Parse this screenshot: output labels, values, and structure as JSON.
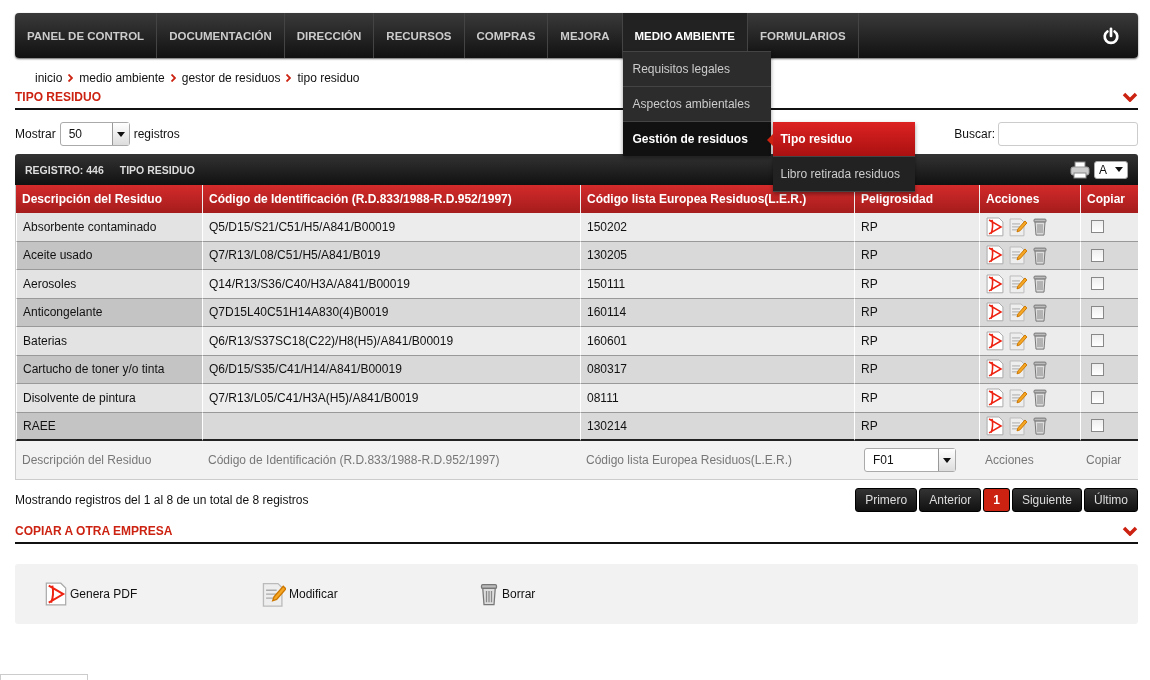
{
  "nav": {
    "items": [
      {
        "label": "PANEL DE CONTROL",
        "selected": false
      },
      {
        "label": "DOCUMENTACIÓN",
        "selected": false
      },
      {
        "label": "DIRECCIÓN",
        "selected": false
      },
      {
        "label": "RECURSOS",
        "selected": false
      },
      {
        "label": "COMPRAS",
        "selected": false
      },
      {
        "label": "MEJORA",
        "selected": false
      },
      {
        "label": "MEDIO AMBIENTE",
        "selected": true,
        "menu": [
          {
            "label": "Requisitos legales",
            "selected": false
          },
          {
            "label": "Aspectos ambientales",
            "selected": false
          },
          {
            "label": "Gestión de residuos",
            "selected": true,
            "submenu": [
              {
                "label": "Tipo residuo",
                "selected": true
              },
              {
                "label": "Libro retirada residuos",
                "selected": false
              }
            ]
          }
        ]
      },
      {
        "label": "FORMULARIOS",
        "selected": false
      }
    ]
  },
  "breadcrumb": [
    "inicio",
    "medio ambiente",
    "gestor de residuos",
    "tipo residuo"
  ],
  "section_title": "TIPO RESIDUO",
  "length_control": {
    "label": "Mostrar",
    "value": "50",
    "suffix": "registros"
  },
  "search": {
    "label": "Buscar:"
  },
  "toolbar": {
    "count": "REGISTRO: 446",
    "title": "TIPO RESIDUO",
    "font_select": "A"
  },
  "table": {
    "columns": [
      "Descripción del Residuo",
      "Código de Identificación (R.D.833/1988-R.D.952/1997)",
      "Código lista Europea Residuos(L.E.R.)",
      "Peligrosidad",
      "Acciones",
      "Copiar"
    ],
    "rows": [
      {
        "descripcion": "Absorbente contaminado",
        "codigo": "Q5/D15/S21/C51/H5/A841/B00019",
        "ler": "150202",
        "peligrosidad": "RP",
        "checked": false
      },
      {
        "descripcion": "Aceite usado",
        "codigo": "Q7/R13/L08/C51/H5/A841/B019",
        "ler": "130205",
        "peligrosidad": "RP",
        "checked": false
      },
      {
        "descripcion": "Aerosoles",
        "codigo": "Q14/R13/S36/C40/H3A/A841/B00019",
        "ler": "150111",
        "peligrosidad": "RP",
        "checked": false
      },
      {
        "descripcion": "Anticongelante",
        "codigo": "Q7D15L40C51H14A830(4)B0019",
        "ler": "160114",
        "peligrosidad": "RP",
        "checked": false
      },
      {
        "descripcion": "Baterias",
        "codigo": "Q6/R13/S37SC18(C22)/H8(H5)/A841/B00019",
        "ler": "160601",
        "peligrosidad": "RP",
        "checked": false
      },
      {
        "descripcion": "Cartucho de toner y/o tinta",
        "codigo": "Q6/D15/S35/C41/H14/A841/B00019",
        "ler": "080317",
        "peligrosidad": "RP",
        "checked": false
      },
      {
        "descripcion": "Disolvente de pintura",
        "codigo": "Q7/R13/L05/C41/H3A(H5)/A841/B0019",
        "ler": "08111",
        "peligrosidad": "RP",
        "checked": false
      },
      {
        "descripcion": "RAEE",
        "ler": "130214",
        "peligrosidad": "RP",
        "checked": false
      }
    ],
    "footer": [
      {
        "kind": "text",
        "label": "Descripción del Residuo"
      },
      {
        "kind": "text",
        "label": "Código de Identificación (R.D.833/1988-R.D.952/1997)"
      },
      {
        "kind": "text",
        "label": "Código lista Europea Residuos(L.E.R.)"
      },
      {
        "kind": "select",
        "value": "F01"
      },
      {
        "kind": "text",
        "label": "Acciones"
      },
      {
        "kind": "text",
        "label": "Copiar"
      }
    ]
  },
  "info": "Mostrando registros del 1 al 8 de un total de 8 registros",
  "pagination": [
    {
      "label": "Primero",
      "selected": false
    },
    {
      "label": "Anterior",
      "selected": false
    },
    {
      "label": "1",
      "selected": true
    },
    {
      "label": "Siguiente",
      "selected": false
    },
    {
      "label": "Último",
      "selected": false
    }
  ],
  "section2_title": "COPIAR A OTRA EMPRESA",
  "legend": [
    {
      "kind": "pdf",
      "label": "Genera PDF"
    },
    {
      "kind": "edit",
      "label": "Modificar"
    },
    {
      "kind": "delete",
      "label": "Borrar"
    }
  ]
}
